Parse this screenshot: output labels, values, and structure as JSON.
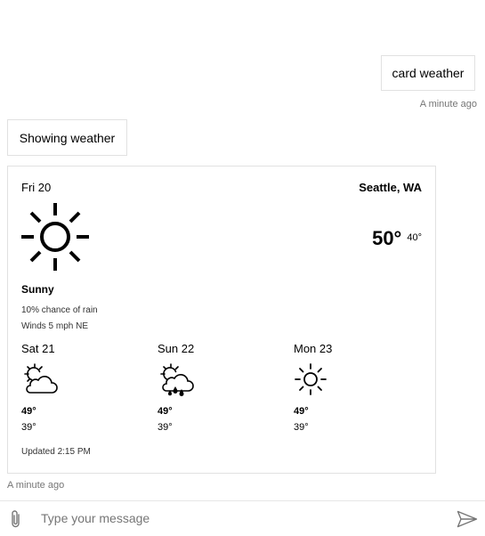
{
  "conversation": {
    "user_message": {
      "text": "card weather",
      "timestamp": "A minute ago"
    },
    "bot_message": {
      "text": "Showing weather",
      "timestamp": "A minute ago"
    }
  },
  "weather_card": {
    "date": "Fri 20",
    "location": "Seattle, WA",
    "current_icon": "sun-icon",
    "temp_high": "50°",
    "temp_low": "40°",
    "condition": "Sunny",
    "rain_chance": "10% chance of rain",
    "winds": "Winds 5 mph NE",
    "forecast": [
      {
        "day": "Sat 21",
        "icon": "partly-cloudy-icon",
        "high": "49°",
        "low": "39°"
      },
      {
        "day": "Sun 22",
        "icon": "rain-cloud-icon",
        "high": "49°",
        "low": "39°"
      },
      {
        "day": "Mon 23",
        "icon": "sun-icon",
        "high": "49°",
        "low": "39°"
      }
    ],
    "updated": "Updated 2:15 PM"
  },
  "input_bar": {
    "placeholder": "Type your message",
    "value": "",
    "attach_icon": "paperclip-icon",
    "send_icon": "send-icon",
    "icon_color": "#767676"
  }
}
